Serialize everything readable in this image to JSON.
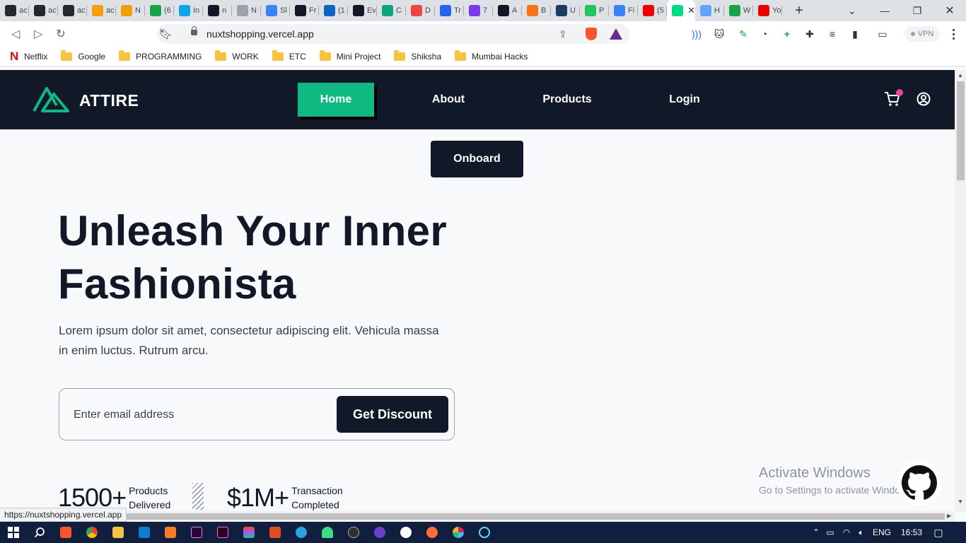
{
  "browser": {
    "tabs": [
      {
        "title": "ac",
        "icon": "github-icon",
        "color": "#24292f"
      },
      {
        "title": "ac",
        "icon": "github-icon",
        "color": "#24292f"
      },
      {
        "title": "ac",
        "icon": "github-icon",
        "color": "#24292f"
      },
      {
        "title": "ac",
        "icon": "moon-icon",
        "color": "#f59e0b"
      },
      {
        "title": "N",
        "icon": "moon-icon",
        "color": "#f59e0b"
      },
      {
        "title": "(6",
        "icon": "six-icon",
        "color": "#16a34a"
      },
      {
        "title": "In",
        "icon": "is-icon",
        "color": "#0ea5e9"
      },
      {
        "title": "n",
        "icon": "notion-a-icon",
        "color": "#111827"
      },
      {
        "title": "N",
        "icon": "chat-icon",
        "color": "#9ca3af"
      },
      {
        "title": "Sl",
        "icon": "bird-icon",
        "color": "#3b82f6"
      },
      {
        "title": "Fr",
        "icon": "reddit-icon",
        "color": "#111827"
      },
      {
        "title": "(1",
        "icon": "linkedin-icon",
        "color": "#0a66c2"
      },
      {
        "title": "Ev",
        "icon": "star-icon",
        "color": "#111827"
      },
      {
        "title": "C",
        "icon": "chatgpt-icon",
        "color": "#10a37f"
      },
      {
        "title": "D",
        "icon": "cloud-icon",
        "color": "#ef4444"
      },
      {
        "title": "Tr",
        "icon": "play-icon",
        "color": "#2563eb"
      },
      {
        "title": "7",
        "icon": "ui-icon",
        "color": "#7c3aed"
      },
      {
        "title": "A",
        "icon": "pulse-icon",
        "color": "#111827"
      },
      {
        "title": "B",
        "icon": "flame-icon",
        "color": "#f97316"
      },
      {
        "title": "U",
        "icon": "tds-icon",
        "color": "#1e3a5f"
      },
      {
        "title": "P",
        "icon": "r-icon",
        "color": "#22c55e"
      },
      {
        "title": "Fi",
        "icon": "k-icon",
        "color": "#3b82f6"
      },
      {
        "title": "(5",
        "icon": "youtube-icon",
        "color": "#ef0000"
      },
      {
        "title": "",
        "icon": "nuxt-icon",
        "color": "#00dc82",
        "active": true
      },
      {
        "title": "H",
        "icon": "robot-icon",
        "color": "#60a5fa"
      },
      {
        "title": "W",
        "icon": "w-icon",
        "color": "#16a34a"
      },
      {
        "title": "Yo",
        "icon": "youtube-music-icon",
        "color": "#ef0000"
      }
    ],
    "url": "nuxtshopping.vercel.app",
    "vpn_label": "VPN",
    "status_url": "https://nuxtshopping.vercel.app",
    "bookmarks": [
      {
        "label": "Netflix",
        "icon": "netflix-icon"
      },
      {
        "label": "Google",
        "icon": "folder-icon"
      },
      {
        "label": "PROGRAMMING",
        "icon": "folder-icon"
      },
      {
        "label": "WORK",
        "icon": "folder-icon"
      },
      {
        "label": "ETC",
        "icon": "folder-icon"
      },
      {
        "label": "Mini Project",
        "icon": "folder-icon"
      },
      {
        "label": "Shiksha",
        "icon": "folder-icon"
      },
      {
        "label": "Mumbai Hacks",
        "icon": "folder-icon"
      }
    ]
  },
  "site": {
    "brand": "ATTIRE",
    "nav": {
      "home": "Home",
      "about": "About",
      "products": "Products",
      "login": "Login"
    },
    "onboard": "Onboard",
    "headline": "Unleash Your Inner Fashionista",
    "lead": "Lorem ipsum dolor sit amet, consectetur adipiscing elit. Vehicula massa in enim luctus. Rutrum arcu.",
    "email_placeholder": "Enter email address",
    "discount_button": "Get Discount",
    "stats": [
      {
        "value": "1500+",
        "label_line1": "Products",
        "label_line2": "Delivered"
      },
      {
        "value": "$1M+",
        "label_line1": "Transaction",
        "label_line2": "Completed"
      }
    ],
    "colors": {
      "nav_bg": "#111827",
      "accent": "#10b981",
      "badge": "#ec4899"
    }
  },
  "os": {
    "watermark_title": "Activate Windows",
    "watermark_sub": "Go to Settings to activate Windows.",
    "language": "ENG",
    "time": "16:53"
  }
}
